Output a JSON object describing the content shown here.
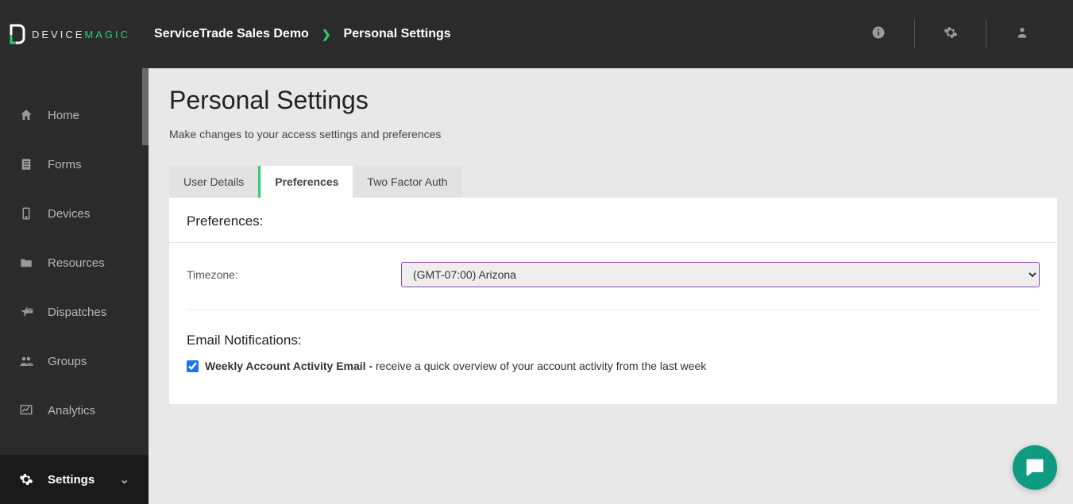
{
  "logo": {
    "text_a": "DEVICE",
    "text_b": "MAGIC"
  },
  "breadcrumb": {
    "org": "ServiceTrade Sales Demo",
    "page": "Personal Settings"
  },
  "sidebar": {
    "items": [
      {
        "label": "Home"
      },
      {
        "label": "Forms"
      },
      {
        "label": "Devices"
      },
      {
        "label": "Resources"
      },
      {
        "label": "Dispatches"
      },
      {
        "label": "Groups"
      },
      {
        "label": "Analytics"
      },
      {
        "label": "Settings"
      }
    ]
  },
  "page": {
    "title": "Personal Settings",
    "subtitle": "Make changes to your access settings and preferences"
  },
  "tabs": [
    {
      "label": "User Details",
      "active": false
    },
    {
      "label": "Preferences",
      "active": true
    },
    {
      "label": "Two Factor Auth",
      "active": false
    }
  ],
  "preferences": {
    "section_label": "Preferences:",
    "timezone_label": "Timezone:",
    "timezone_value": "(GMT-07:00) Arizona",
    "email_section_label": "Email Notifications:",
    "weekly_email_bold": "Weekly Account Activity Email - ",
    "weekly_email_desc": "receive a quick overview of your account activity from the last week",
    "weekly_email_checked": true
  },
  "colors": {
    "accent_green": "#2ecc71",
    "select_border": "#8e44ad",
    "arrow": "#f5a623",
    "chat": "#0f9b82"
  }
}
